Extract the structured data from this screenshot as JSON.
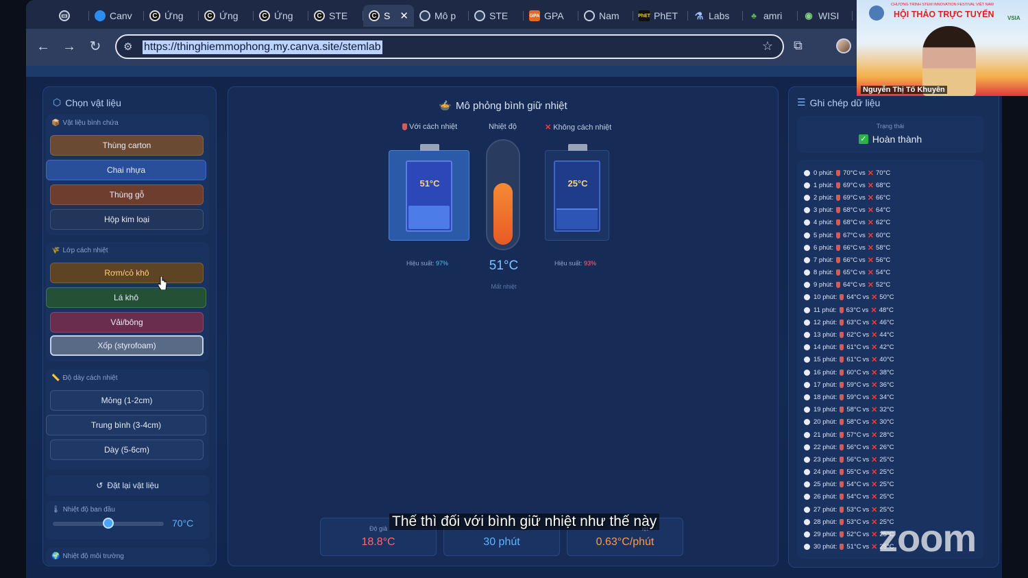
{
  "browser": {
    "tabs": [
      {
        "label": "",
        "icon": "window-icon"
      },
      {
        "label": "Canv",
        "icon": "canva-icon"
      },
      {
        "label": "Ứng",
        "icon": "c-icon"
      },
      {
        "label": "Ứng",
        "icon": "c-icon"
      },
      {
        "label": "Ứng",
        "icon": "c-icon"
      },
      {
        "label": "STE",
        "icon": "c-icon"
      },
      {
        "label": "S",
        "icon": "c-icon",
        "active": true
      },
      {
        "label": "Mô p",
        "icon": "globe-icon"
      },
      {
        "label": "STE",
        "icon": "globe-icon"
      },
      {
        "label": "GPA",
        "icon": "gpa-icon"
      },
      {
        "label": "Nam",
        "icon": "nam-icon"
      },
      {
        "label": "PhET",
        "icon": "phet-icon"
      },
      {
        "label": "Labs",
        "icon": "flask-icon"
      },
      {
        "label": "amri",
        "icon": "plant-icon"
      },
      {
        "label": "WISI",
        "icon": "wisi-icon"
      }
    ],
    "url": "https://thinghiemmophong.my.canva.site/stemlab"
  },
  "left": {
    "title": "Chọn vật liệu",
    "container_group": {
      "title": "Vật liệu bình chứa",
      "options": [
        "Thùng carton",
        "Chai nhựa",
        "Thùng gỗ",
        "Hộp kim loại"
      ]
    },
    "insulation_group": {
      "title": "Lớp cách nhiệt",
      "options": [
        "Rơm/cỏ khô",
        "Lá khô",
        "Vải/bông",
        "Xốp (styrofoam)"
      ]
    },
    "thickness_group": {
      "title": "Độ dày cách nhiệt",
      "options": [
        "Mỏng (1-2cm)",
        "Trung bình (3-4cm)",
        "Dày (5-6cm)"
      ]
    },
    "reset_label": "Đặt lại vật liệu",
    "initial_temp": {
      "title": "Nhiệt độ ban đầu",
      "value": "70°C",
      "fraction": 0.5
    },
    "env_temp": {
      "title": "Nhiệt độ môi trường"
    }
  },
  "middle": {
    "title": "Mô phỏng bình giữ nhiệt",
    "insulated": {
      "label": "Với cách nhiệt",
      "temp": "51°C",
      "eff_label": "Hiệu suất:",
      "eff_value": "97%"
    },
    "thermo": {
      "label": "Nhiệt độ",
      "value": "51°C",
      "sub": "Mất nhiệt",
      "fill_fraction": 0.6
    },
    "bare": {
      "label": "Không cách nhiệt",
      "temp": "25°C",
      "eff_label": "Hiệu suất:",
      "eff_value": "93%"
    },
    "stats": [
      {
        "label": "Độ giả",
        "value": "18.8°C",
        "color": "#ff6b6b"
      },
      {
        "label": "",
        "value": "30 phút",
        "color": "#5fb4ff"
      },
      {
        "label": "iệt",
        "value": "0.63°C/phút",
        "color": "#ff9a4a"
      }
    ]
  },
  "right": {
    "title": "Ghi chép dữ liệu",
    "status_label": "Trạng thái",
    "status_value": "Hoàn thành",
    "log": [
      {
        "minute": "0 phút:",
        "with": "70°C",
        "without": "70°C"
      },
      {
        "minute": "1 phút:",
        "with": "69°C",
        "without": "68°C"
      },
      {
        "minute": "2 phút:",
        "with": "69°C",
        "without": "66°C"
      },
      {
        "minute": "3 phút:",
        "with": "68°C",
        "without": "64°C"
      },
      {
        "minute": "4 phút:",
        "with": "68°C",
        "without": "62°C"
      },
      {
        "minute": "5 phút:",
        "with": "67°C",
        "without": "60°C"
      },
      {
        "minute": "6 phút:",
        "with": "66°C",
        "without": "58°C"
      },
      {
        "minute": "7 phút:",
        "with": "66°C",
        "without": "56°C"
      },
      {
        "minute": "8 phút:",
        "with": "65°C",
        "without": "54°C"
      },
      {
        "minute": "9 phút:",
        "with": "64°C",
        "without": "52°C"
      },
      {
        "minute": "10 phút:",
        "with": "64°C",
        "without": "50°C"
      },
      {
        "minute": "11 phút:",
        "with": "63°C",
        "without": "48°C"
      },
      {
        "minute": "12 phút:",
        "with": "63°C",
        "without": "46°C"
      },
      {
        "minute": "13 phút:",
        "with": "62°C",
        "without": "44°C"
      },
      {
        "minute": "14 phút:",
        "with": "61°C",
        "without": "42°C"
      },
      {
        "minute": "15 phút:",
        "with": "61°C",
        "without": "40°C"
      },
      {
        "minute": "16 phút:",
        "with": "60°C",
        "without": "38°C"
      },
      {
        "minute": "17 phút:",
        "with": "59°C",
        "without": "36°C"
      },
      {
        "minute": "18 phút:",
        "with": "59°C",
        "without": "34°C"
      },
      {
        "minute": "19 phút:",
        "with": "58°C",
        "without": "32°C"
      },
      {
        "minute": "20 phút:",
        "with": "58°C",
        "without": "30°C"
      },
      {
        "minute": "21 phút:",
        "with": "57°C",
        "without": "28°C"
      },
      {
        "minute": "22 phút:",
        "with": "56°C",
        "without": "26°C"
      },
      {
        "minute": "23 phút:",
        "with": "56°C",
        "without": "25°C"
      },
      {
        "minute": "24 phút:",
        "with": "55°C",
        "without": "25°C"
      },
      {
        "minute": "25 phút:",
        "with": "54°C",
        "without": "25°C"
      },
      {
        "minute": "26 phút:",
        "with": "54°C",
        "without": "25°C"
      },
      {
        "minute": "27 phút:",
        "with": "53°C",
        "without": "25°C"
      },
      {
        "minute": "28 phút:",
        "with": "53°C",
        "without": "25°C"
      },
      {
        "minute": "29 phút:",
        "with": "52°C",
        "without": "25°C"
      },
      {
        "minute": "30 phút:",
        "with": "51°C",
        "without": "25°C"
      }
    ]
  },
  "overlay": {
    "subtitle": "Thế thì đối với bình giữ nhiệt như thế này",
    "zoom_watermark": "zoom",
    "webcam": {
      "banner_small": "CHƯƠNG TRÌNH STEM INNOVATION FESTIVAL VIỆT NAM",
      "banner": "HỘI THẢO TRỰC TUYẾN",
      "speaker": "Nguyễn Thị Tố Khuyên"
    }
  },
  "colors": {
    "page_bg": "#13244a",
    "accent_blue": "#5fb4ff",
    "warm": "#ff9a4a",
    "bad": "#ff6b6b"
  }
}
